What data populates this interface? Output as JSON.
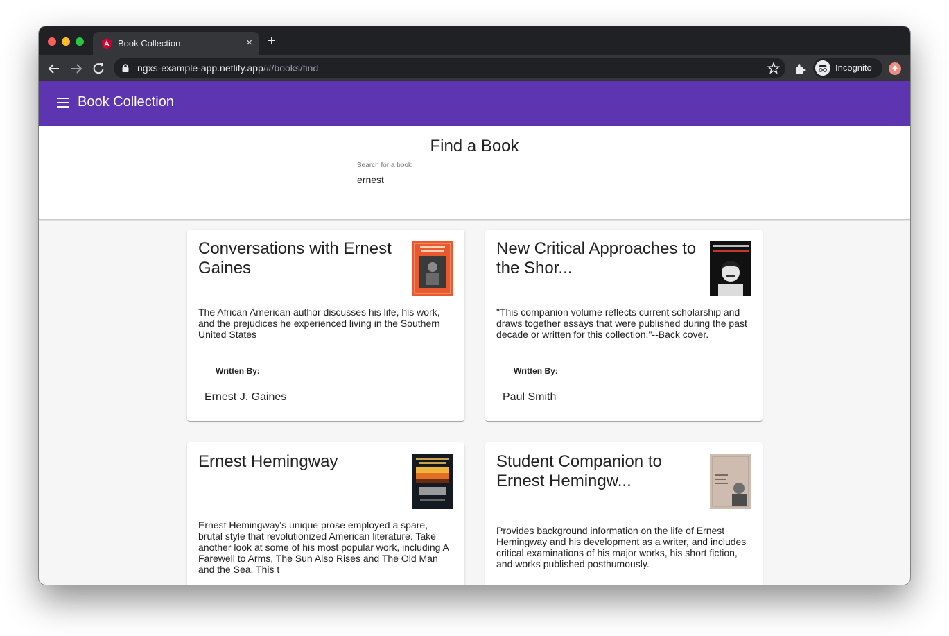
{
  "browser": {
    "tab_title": "Book Collection",
    "tab_close": "×",
    "new_tab": "+",
    "url_host": "ngxs-example-app.netlify.app",
    "url_path": "/#/books/find",
    "profile_label": "Incognito",
    "icons": [
      "angular-icon",
      "back-icon",
      "forward-icon",
      "reload-icon",
      "lock-icon",
      "star-icon",
      "extensions-icon",
      "incognito-icon",
      "update-icon"
    ]
  },
  "app": {
    "title": "Book Collection",
    "accent": "#5e35b1"
  },
  "search": {
    "heading": "Find a Book",
    "label": "Search for a book",
    "value": "ernest"
  },
  "books": [
    {
      "title": "Conversations with Ernest Gaines",
      "description": "The African American author discusses his life, his work, and the prejudices he experienced living in the Southern United States",
      "written_by_label": "Written By:",
      "author": "Ernest J. Gaines"
    },
    {
      "title": "New Critical Approaches to the Shor...",
      "description": "\"This companion volume reflects current scholarship and draws together essays that were published during the past decade or written for this collection.\"--Back cover.",
      "written_by_label": "Written By:",
      "author": "Paul Smith"
    },
    {
      "title": "Ernest Hemingway",
      "description": "Ernest Hemingway's unique prose employed a spare, brutal style that revolutionized American literature. Take another look at some of his most popular work, including A Farewell to Arms, The Sun Also Rises and The Old Man and the Sea. This t"
    },
    {
      "title": "Student Companion to Ernest Hemingw...",
      "description": "Provides background information on the life of Ernest Hemingway and his development as a writer, and includes critical examinations of his major works, his short fiction, and works published posthumously."
    }
  ]
}
